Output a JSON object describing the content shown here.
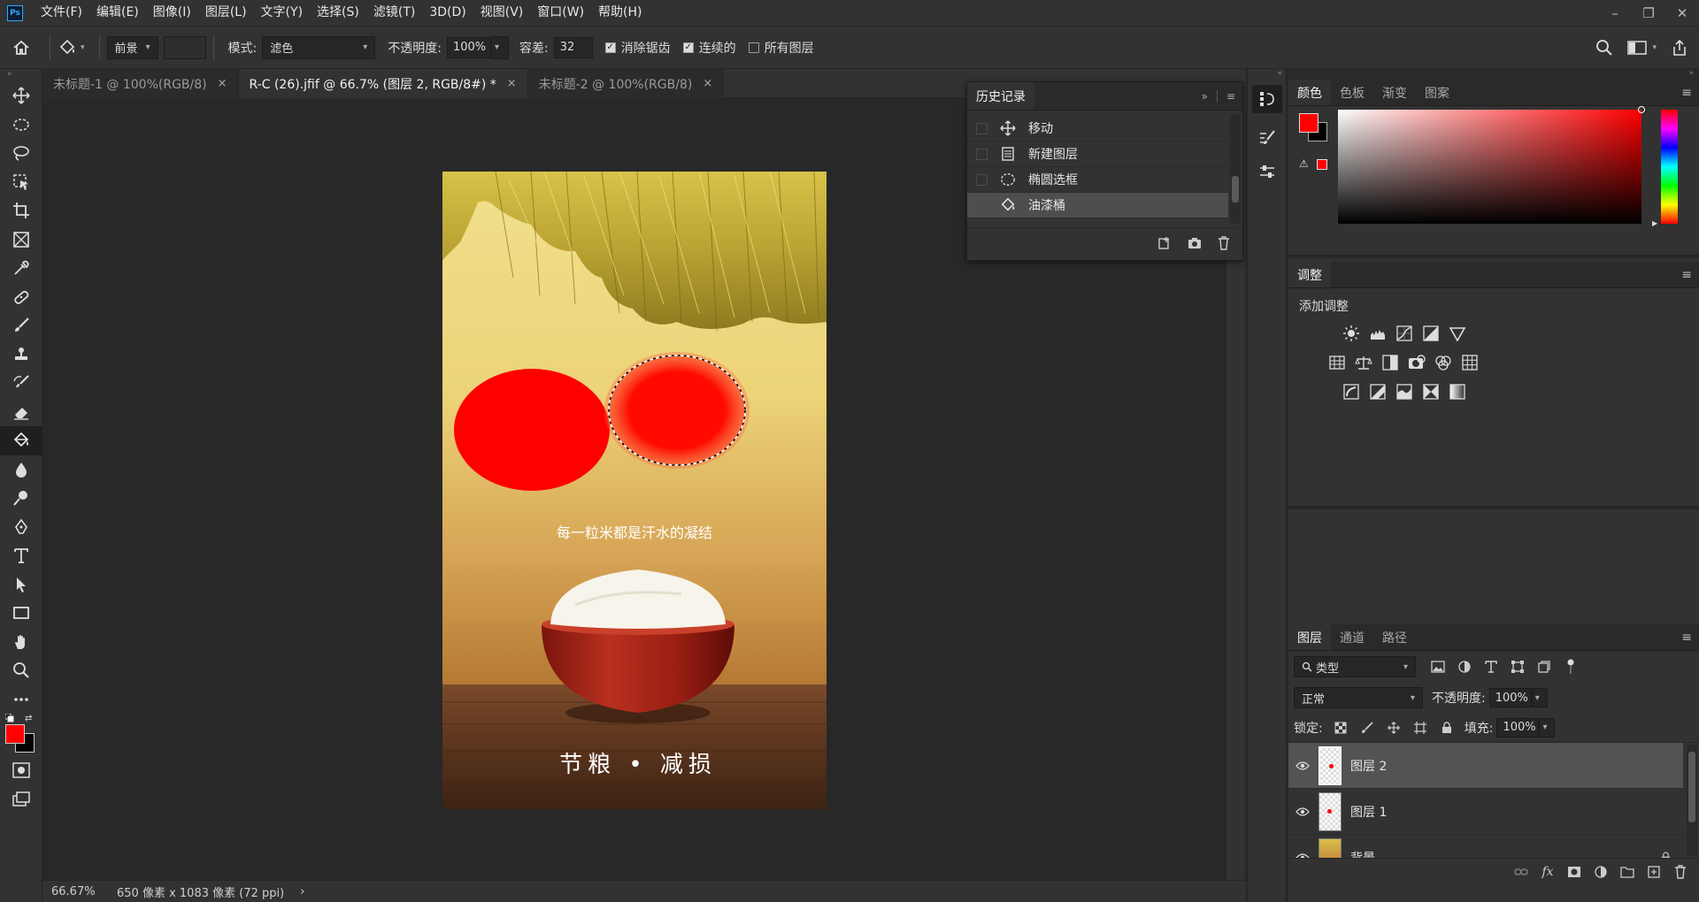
{
  "app": {
    "logo": "Ps"
  },
  "menu": [
    "文件(F)",
    "编辑(E)",
    "图像(I)",
    "图层(L)",
    "文字(Y)",
    "选择(S)",
    "滤镜(T)",
    "3D(D)",
    "视图(V)",
    "窗口(W)",
    "帮助(H)"
  ],
  "window_controls": {
    "minimize": "–",
    "restore": "❐",
    "close": "✕"
  },
  "options": {
    "fill_source": "前景",
    "mode_label": "模式:",
    "mode_value": "滤色",
    "opacity_label": "不透明度:",
    "opacity_value": "100%",
    "tolerance_label": "容差:",
    "tolerance_value": "32",
    "antialias_label": "消除锯齿",
    "antialias_checked": true,
    "contiguous_label": "连续的",
    "contiguous_checked": true,
    "all_layers_label": "所有图层",
    "all_layers_checked": false
  },
  "doc_tabs": [
    {
      "label": "未标题-1 @ 100%(RGB/8)",
      "active": false
    },
    {
      "label": "R-C (26).jfif @ 66.7% (图层 2, RGB/8#) *",
      "active": true
    },
    {
      "label": "未标题-2 @ 100%(RGB/8)",
      "active": false
    }
  ],
  "tab_close": "×",
  "poster": {
    "slogan": "每一粒米都是汗水的凝结",
    "bottom_text": "节粮 • 减损"
  },
  "status": {
    "zoom": "66.67%",
    "info": "650 像素 x 1083 像素 (72 ppi)",
    "arrow": "›"
  },
  "history": {
    "title": "历史记录",
    "items": [
      {
        "label": "移动",
        "icon": "move-icon",
        "selected": false
      },
      {
        "label": "新建图层",
        "icon": "new-layer-icon",
        "selected": false
      },
      {
        "label": "椭圆选框",
        "icon": "ellipse-marquee-icon",
        "selected": false
      },
      {
        "label": "油漆桶",
        "icon": "paint-bucket-icon",
        "selected": true
      }
    ]
  },
  "color_panel": {
    "tabs": [
      "颜色",
      "色板",
      "渐变",
      "图案"
    ],
    "foreground": "#ff0000",
    "background": "#000000"
  },
  "adjust_panel": {
    "tab": "调整",
    "add_label": "添加调整"
  },
  "layers_panel": {
    "tabs": [
      "图层",
      "通道",
      "路径"
    ],
    "filter_label": "类型",
    "blend_mode": "正常",
    "opacity_label": "不透明度:",
    "opacity_value": "100%",
    "lock_label": "锁定:",
    "fill_label": "填充:",
    "fill_value": "100%",
    "layers": [
      {
        "name": "图层 2",
        "selected": true
      },
      {
        "name": "图层 1",
        "selected": false
      },
      {
        "name": "背景",
        "selected": false
      }
    ]
  },
  "colors": {
    "accent": "#31a8ff",
    "fg": "#ff0000",
    "bg": "#000000"
  }
}
